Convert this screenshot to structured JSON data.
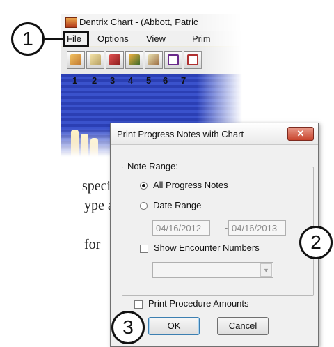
{
  "background_text": {
    "line1": "specific to",
    "line2": "ype a date",
    "line3": "for"
  },
  "app": {
    "title": "Dentrix Chart - (Abbott, Patric",
    "menu": [
      "File",
      "Options",
      "View",
      "Prim"
    ],
    "tooth_numbers": [
      "1",
      "2",
      "3",
      "4",
      "5",
      "6",
      "7"
    ],
    "toolbar_icons": [
      "patient-chart-icon",
      "notes-icon",
      "book-icon",
      "chair-icon",
      "pen-icon",
      "frame-icon",
      "form-icon"
    ]
  },
  "dialog": {
    "title": "Print Progress Notes with Chart",
    "close_label": "✕",
    "note_range_label": "Note Range:",
    "option_all": "All Progress Notes",
    "option_all_selected": true,
    "option_date": "Date Range",
    "date_from": "04/16/2012",
    "date_sep": "-",
    "date_to": "04/16/2013",
    "show_encounter_label": "Show Encounter Numbers",
    "show_encounter_checked": false,
    "print_amounts_label": "Print Procedure Amounts",
    "print_amounts_checked": false,
    "ok_label": "OK",
    "cancel_label": "Cancel"
  },
  "callouts": {
    "one": "1",
    "two": "2",
    "three": "3"
  }
}
